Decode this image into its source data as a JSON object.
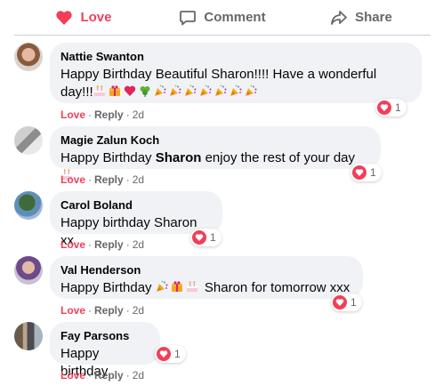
{
  "actions": {
    "love": "Love",
    "comment": "Comment",
    "share": "Share"
  },
  "colors": {
    "love": "#f33e58",
    "muted": "#65676b",
    "bubble": "#f0f2f5"
  },
  "comments": [
    {
      "author": "Nattie Swanton",
      "text_line1": "Happy Birthday Beautiful Sharon!!!! Have a wonderful",
      "text_line2": "day!!!",
      "emojis": [
        "cake",
        "gift",
        "heart",
        "shamrock",
        "party-popper",
        "party-popper",
        "party-popper",
        "party-popper",
        "party-popper",
        "party-popper",
        "party-popper"
      ],
      "reaction_count": "1",
      "love": "Love",
      "reply": "Reply",
      "time": "2d"
    },
    {
      "author": "Magie Zalun Koch",
      "text_before": "Happy Birthday ",
      "text_bold": "Sharon",
      "text_after": " enjoy the rest of your day",
      "emojis": [
        "cake"
      ],
      "reaction_count": "1",
      "love": "Love",
      "reply": "Reply",
      "time": "2d"
    },
    {
      "author": "Carol Boland",
      "text": "Happy birthday Sharon xx",
      "reaction_count": "1",
      "love": "Love",
      "reply": "Reply",
      "time": "2d"
    },
    {
      "author": "Val Henderson",
      "text_before": "Happy Birthday ",
      "emojis": [
        "party-popper",
        "gift",
        "cake"
      ],
      "text_after": " Sharon for tomorrow xxx",
      "reaction_count": "1",
      "love": "Love",
      "reply": "Reply",
      "time": "2d"
    },
    {
      "author": "Fay Parsons",
      "text": "Happy birthday",
      "reaction_count": "1",
      "love": "Love",
      "reply": "Reply",
      "time": "2d"
    }
  ]
}
